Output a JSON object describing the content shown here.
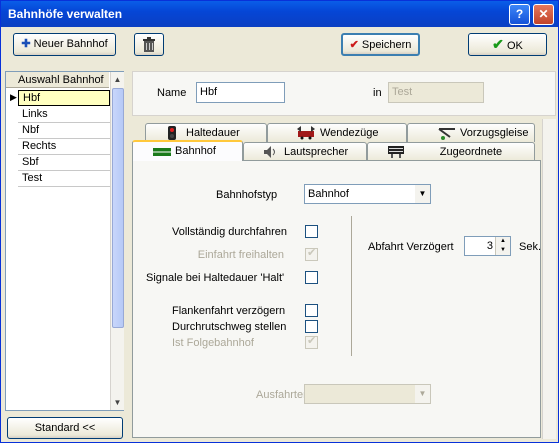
{
  "window": {
    "title": "Bahnhöfe verwalten",
    "controls": [
      "?",
      "✕"
    ]
  },
  "toolbar": {
    "new_label": "Neuer Bahnhof",
    "save_label": "Speichern",
    "ok_label": "OK"
  },
  "list": {
    "header": "Auswahl Bahnhof",
    "items": [
      "Hbf",
      "Links",
      "Nbf",
      "Rechts",
      "Sbf",
      "Test"
    ],
    "selected": "Hbf",
    "standard_button": "Standard <<"
  },
  "detail": {
    "name_label": "Name",
    "name_value": "Hbf",
    "in_label": "in",
    "in_value": "Test"
  },
  "tabs": {
    "row1": [
      "Haltedauer",
      "Wendezüge",
      "Vorzugsgleise"
    ],
    "row2": [
      "Bahnhof",
      "Lautsprecher",
      "Zugeordnete Zuganzeiger"
    ],
    "active": "Bahnhof"
  },
  "form": {
    "typ_label": "Bahnhofstyp",
    "typ_value": "Bahnhof",
    "checks": [
      {
        "label": "Vollständig durchfahren",
        "checked": false,
        "enabled": true
      },
      {
        "label": "Einfahrt freihalten",
        "checked": true,
        "enabled": false
      },
      {
        "label": "Signale bei Haltedauer 'Halt'",
        "checked": false,
        "enabled": true
      },
      {
        "label": "Flankenfahrt verzögern",
        "checked": false,
        "enabled": true
      },
      {
        "label": "Durchrutschweg stellen",
        "checked": false,
        "enabled": true
      },
      {
        "label": "Ist Folgebahnhof",
        "checked": true,
        "enabled": false
      }
    ],
    "delay_label": "Abfahrt Verzögert",
    "delay_value": "3",
    "delay_unit": "Sek.",
    "ausfahrten_label": "Ausfahrten",
    "ausfahrten_value": ""
  },
  "colors": {
    "titlebar": "#0546d6",
    "accent": "#ffc83c",
    "selection": "#ffffc0"
  }
}
